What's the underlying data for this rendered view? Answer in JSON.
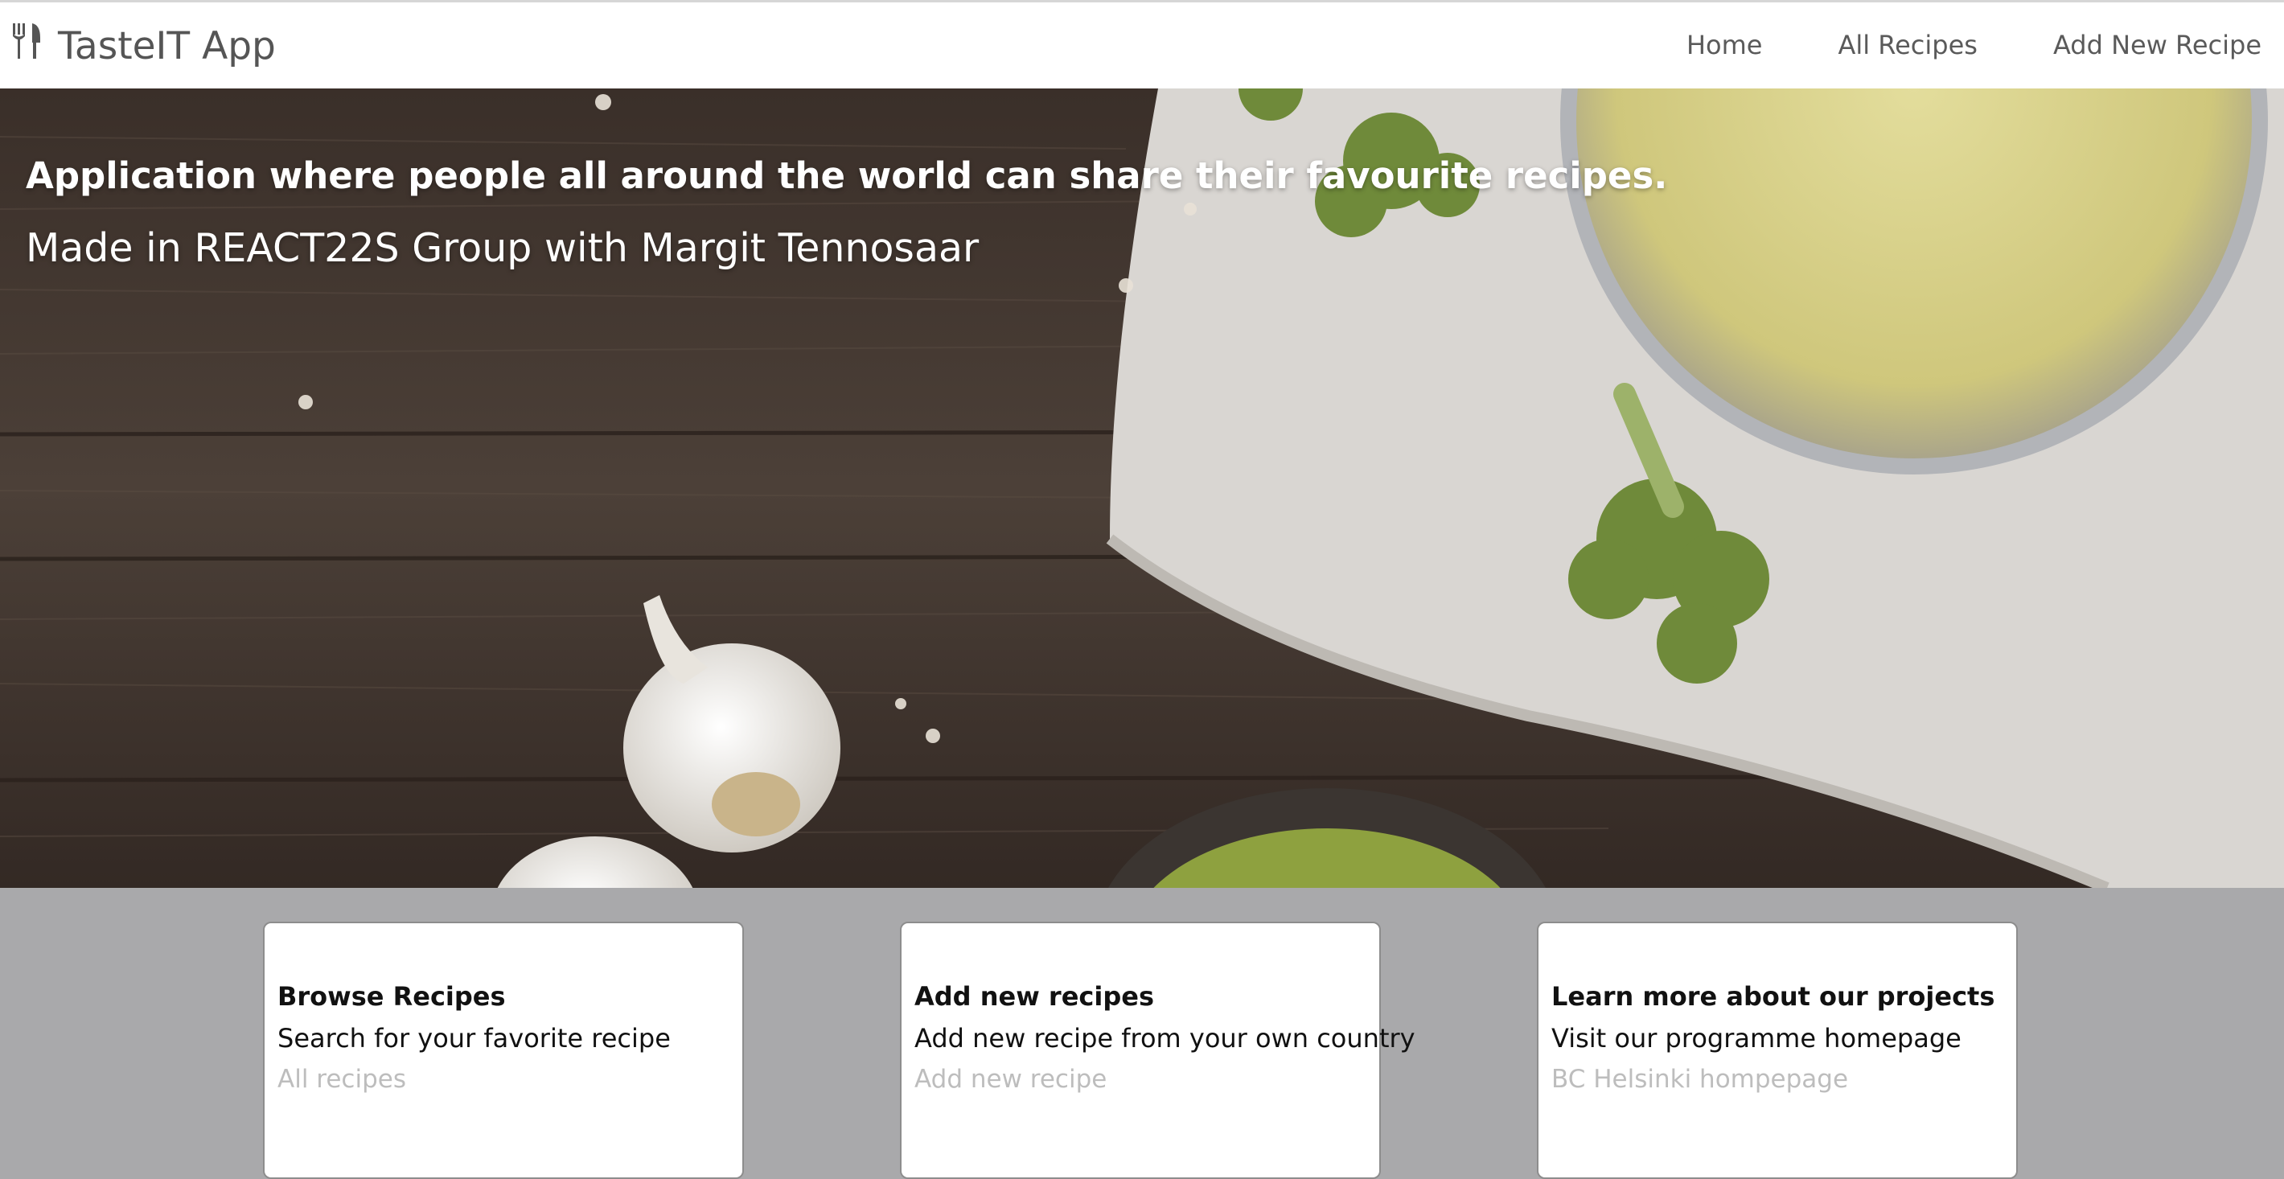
{
  "app": {
    "title": "TasteIT App",
    "logo_icon": "fork-knife-icon"
  },
  "nav": {
    "items": [
      {
        "label": "Home"
      },
      {
        "label": "All Recipes"
      },
      {
        "label": "Add New Recipe"
      }
    ]
  },
  "hero": {
    "headline": "Application where people all around the world can share their favourite recipes.",
    "subtitle": "Made in REACT22S Group with Margit Tennosaar"
  },
  "cards": [
    {
      "title": "Browse Recipes",
      "text": "Search for your favorite recipe",
      "link": "All recipes"
    },
    {
      "title": "Add new recipes",
      "text": "Add new recipe from your own country",
      "link": "Add new recipe"
    },
    {
      "title": "Learn more about our projects",
      "text": "Visit our programme homepage",
      "link": "BC Helsinki hompepage"
    }
  ],
  "colors": {
    "header_bg": "#ffffff",
    "nav_text": "#5a5a5a",
    "page_bg": "#a9a9ab",
    "card_link": "#bdbdbd"
  }
}
